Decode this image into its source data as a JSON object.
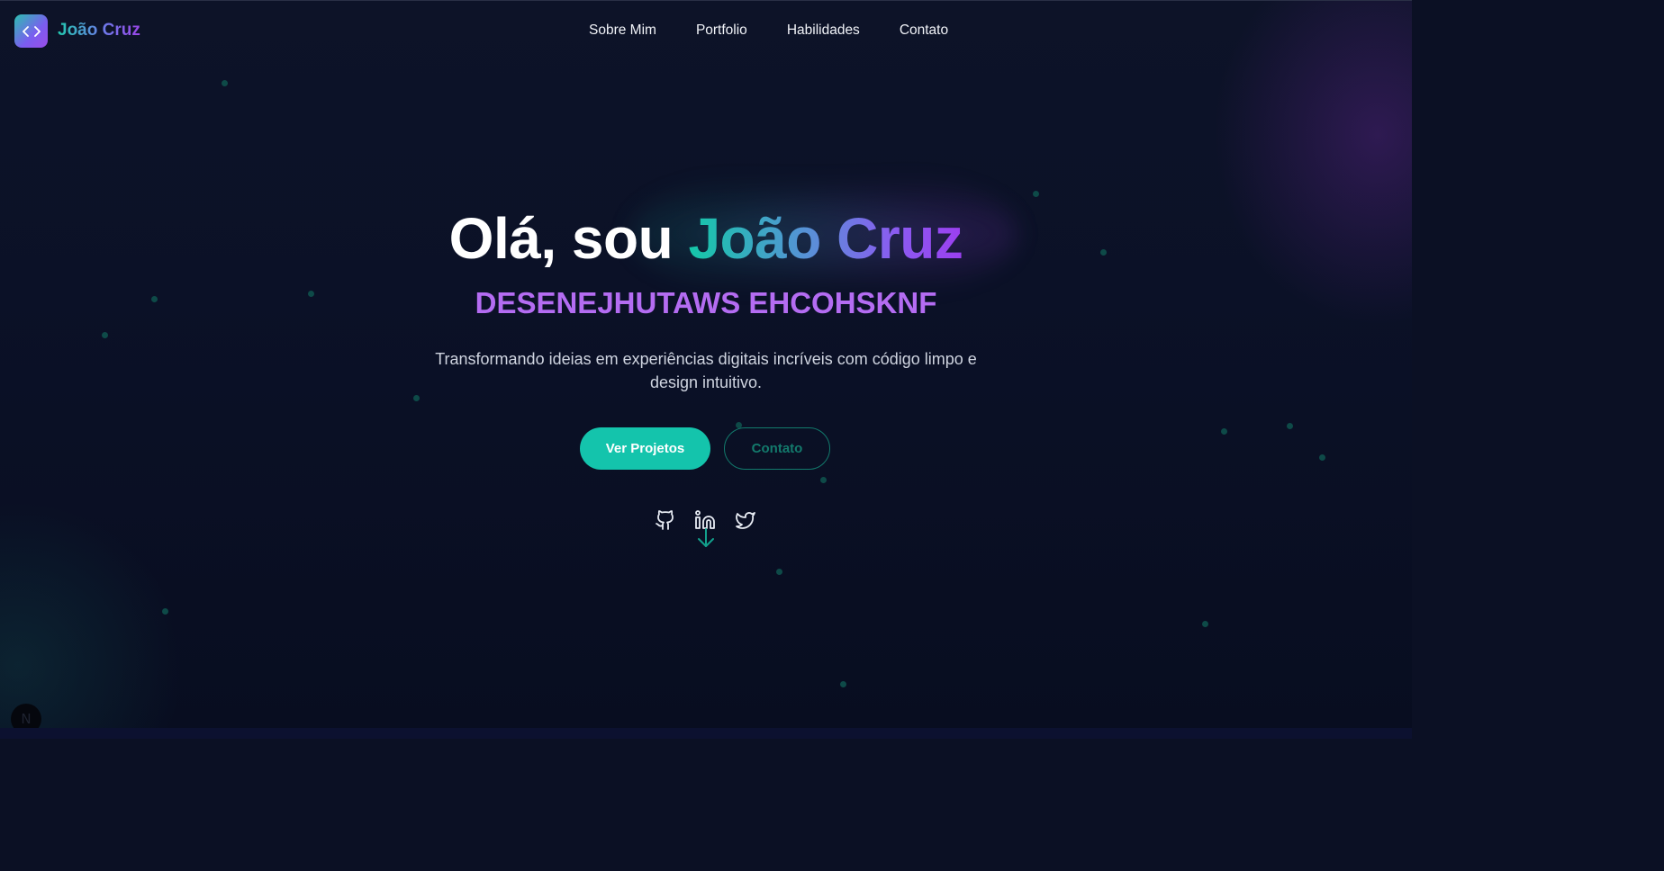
{
  "nav": {
    "brand": "João Cruz",
    "logo_icon": "code-brackets-icon",
    "links": [
      "Sobre Mim",
      "Portfolio",
      "Habilidades",
      "Contato"
    ]
  },
  "hero": {
    "greeting": "Olá, sou ",
    "name": "João Cruz",
    "subtitle": "DESENEJHUTAWS EHCOHSKNF",
    "description": "Transformando ideias em experiências digitais incríveis com código limpo e design intuitivo.",
    "primary_button": "Ver Projetos",
    "secondary_button": "Contato",
    "social_icons": [
      "github-icon",
      "linkedin-icon",
      "twitter-icon"
    ],
    "scroll_icon": "arrow-down-icon"
  },
  "badge": {
    "label": "N"
  },
  "colors": {
    "accent_teal": "#14c4ac",
    "accent_purple": "#9b3ff0",
    "subtitle_purple": "#b46cf2",
    "background": "#0b1024"
  }
}
